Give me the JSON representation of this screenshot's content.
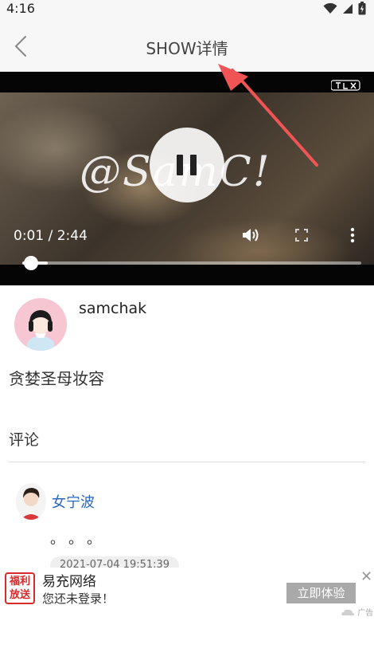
{
  "status_bar": {
    "time": "4:16",
    "icons": [
      "wifi-icon",
      "signal-icon",
      "battery-charging-icon"
    ]
  },
  "nav": {
    "title": "SHOW详情",
    "back_icon": "chevron-left-icon"
  },
  "video": {
    "overlay_text": "@SamC!",
    "current_time": "0:01",
    "separator": " / ",
    "duration": "2:44",
    "progress_fraction": 0.025,
    "buffered_fraction": 0.075,
    "control_icons": [
      "pause-icon",
      "volume-icon",
      "fullscreen-icon",
      "more-vert-icon"
    ]
  },
  "author": {
    "name": "samchak"
  },
  "show": {
    "title": "贪婪圣母妆容"
  },
  "comments_section": {
    "label": "评论",
    "items": [
      {
        "user": "女宁波",
        "text": "。。。",
        "timestamp": "2021-07-04 19:51:39"
      }
    ]
  },
  "ad": {
    "badge_line1": "福利",
    "badge_line2": "放送",
    "title": "易充网络",
    "subtitle": "您还未登录！",
    "cta": "立即体验",
    "close": "✕",
    "mark": "广告"
  },
  "colors": {
    "accent_link": "#2a66c6",
    "annotation_arrow": "#f05454",
    "ad_badge": "#d82a2a"
  }
}
